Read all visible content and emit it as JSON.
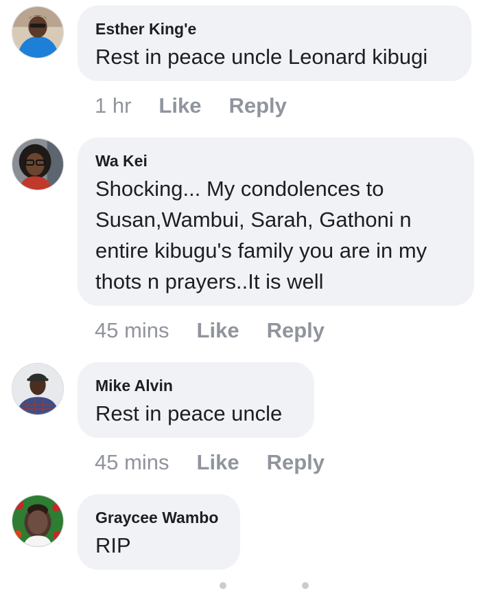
{
  "comments": [
    {
      "author": "Esther King'e",
      "text": "Rest in peace uncle Leonard kibugi",
      "time": "1 hr",
      "like_label": "Like",
      "reply_label": "Reply",
      "avatar_icon": "profile-photo-icon"
    },
    {
      "author": "Wa Kei",
      "text": "Shocking... My condolences to\nSusan,Wambui, Sarah, Gathoni n\nentire kibugu's family you are in my\nthots n prayers..It is well",
      "time": "45 mins",
      "like_label": "Like",
      "reply_label": "Reply",
      "avatar_icon": "profile-photo-icon"
    },
    {
      "author": "Mike Alvin",
      "text": "Rest in peace uncle",
      "time": "45 mins",
      "like_label": "Like",
      "reply_label": "Reply",
      "avatar_icon": "profile-photo-icon"
    },
    {
      "author": "Graycee Wambo",
      "text": "RIP",
      "avatar_icon": "profile-photo-icon"
    }
  ],
  "colors": {
    "bubble_bg": "#f0f2f5",
    "text": "#1c1e21",
    "meta": "#90949c"
  }
}
